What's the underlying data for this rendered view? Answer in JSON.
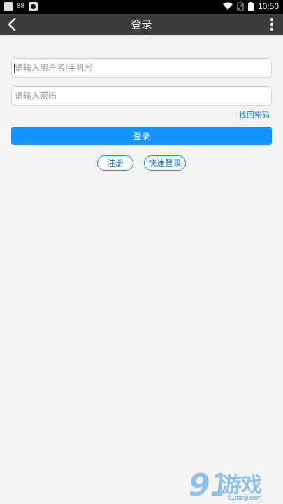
{
  "status_bar": {
    "time": "10:50",
    "icons": [
      "document-icon",
      "signal-icon",
      "app-icon",
      "wifi-icon",
      "sim-card-icon",
      "battery-icon"
    ]
  },
  "header": {
    "title": "登录",
    "back_icon": "chevron-left-icon",
    "menu_icon": "more-vertical-icon"
  },
  "form": {
    "username": {
      "value": "",
      "placeholder": "请输入用户名/手机号"
    },
    "password": {
      "value": "",
      "placeholder": "请输入密码"
    },
    "forgot_password_label": "找回密码",
    "login_label": "登录",
    "register_label": "注册",
    "quick_login_label": "快速登录"
  },
  "watermark": {
    "logo_text": "91",
    "brand": "游戏",
    "url": "91danji.com"
  },
  "colors": {
    "status_bar": "#000000",
    "title_bar": "#3b3b3b",
    "background": "#f3f3f3",
    "primary": "#1593ff",
    "link": "#1a7fc9"
  }
}
